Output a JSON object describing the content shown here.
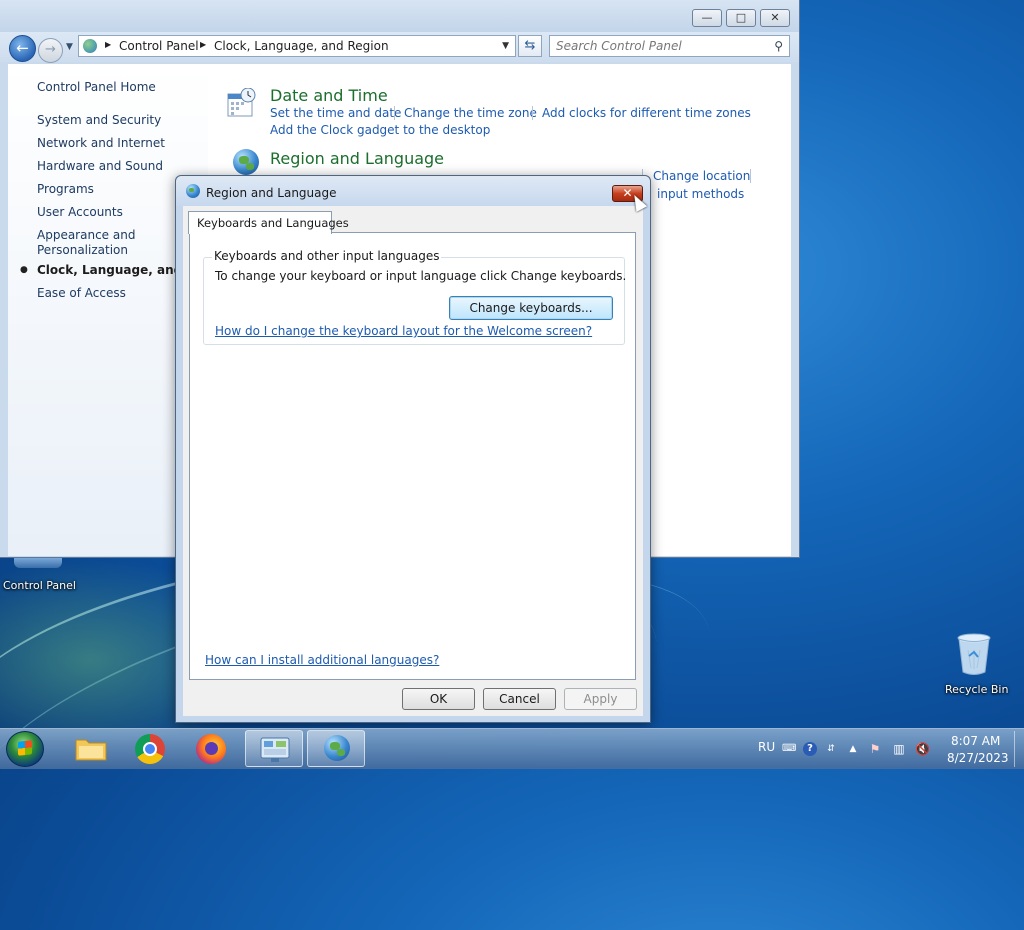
{
  "desktop": {
    "icons": [
      {
        "label": "Control Panel"
      },
      {
        "label": "Recycle Bin"
      }
    ]
  },
  "cp_window": {
    "window_buttons": {
      "minimize": "—",
      "maximize": "□",
      "close": "✕"
    },
    "address": {
      "crumbs": [
        "Control Panel",
        "Clock, Language, and Region"
      ]
    },
    "search": {
      "placeholder": "Search Control Panel"
    },
    "left_pane": {
      "home": "Control Panel Home",
      "items": [
        "System and Security",
        "Network and Internet",
        "Hardware and Sound",
        "Programs",
        "User Accounts",
        "Appearance and",
        "Personalization",
        "Clock, Language, and Reg",
        "Ease of Access"
      ]
    },
    "categories": {
      "date_time": {
        "title": "Date and Time",
        "links": [
          "Set the time and date",
          "Change the time zone",
          "Add clocks for different time zones",
          "Add the Clock gadget to the desktop"
        ]
      },
      "region_language": {
        "title": "Region and Language",
        "links": [
          "Change location",
          "input methods"
        ]
      }
    }
  },
  "dialog": {
    "title": "Region and Language",
    "close_glyph": "✕",
    "tabs": [
      {
        "label": "Keyboards and Languages"
      }
    ],
    "group": {
      "title": "Keyboards and other input languages",
      "description": "To change your keyboard or input language click Change keyboards.",
      "button": "Change keyboards...",
      "link": "How do I change the keyboard layout for the Welcome screen?"
    },
    "install_link": "How can I install additional languages?",
    "buttons": {
      "ok": "OK",
      "cancel": "Cancel",
      "apply": "Apply"
    }
  },
  "taskbar": {
    "language": "RU",
    "time": "8:07 AM",
    "date": "8/27/2023"
  }
}
